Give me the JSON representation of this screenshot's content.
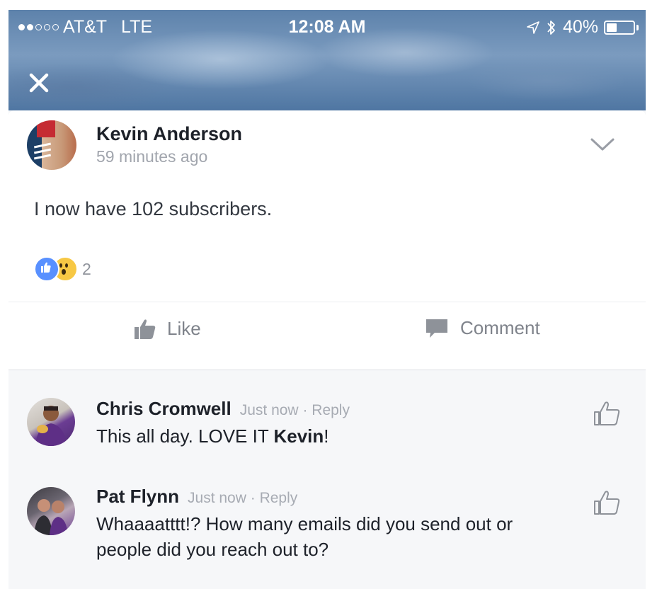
{
  "status_bar": {
    "carrier": "AT&T",
    "network": "LTE",
    "time": "12:08 AM",
    "battery_percent": "40%",
    "battery_level": 0.4,
    "signal_bars_filled": 2,
    "signal_bars_total": 5
  },
  "header": {
    "close_icon": "close-icon"
  },
  "post": {
    "author": "Kevin Anderson",
    "time": "59 minutes ago",
    "text": "I now have 102 subscribers.",
    "reactions": [
      "like",
      "wow"
    ],
    "reaction_count": "2",
    "like_label": "Like",
    "comment_label": "Comment"
  },
  "comments": [
    {
      "name": "Chris Cromwell",
      "time": "Just now",
      "separator": "·",
      "reply_label": "Reply",
      "text_before": "This all day. LOVE IT ",
      "text_bold": "Kevin",
      "text_after": "!"
    },
    {
      "name": "Pat Flynn",
      "time": "Just now",
      "separator": "·",
      "reply_label": "Reply",
      "text": "Whaaaatttt!? How many emails did you send out or people did you reach out to?"
    }
  ],
  "colors": {
    "accent_blue": "#5890ff",
    "wow_yellow": "#f7c844",
    "text_dark": "#1d2129",
    "text_muted": "#a1a5ad"
  }
}
